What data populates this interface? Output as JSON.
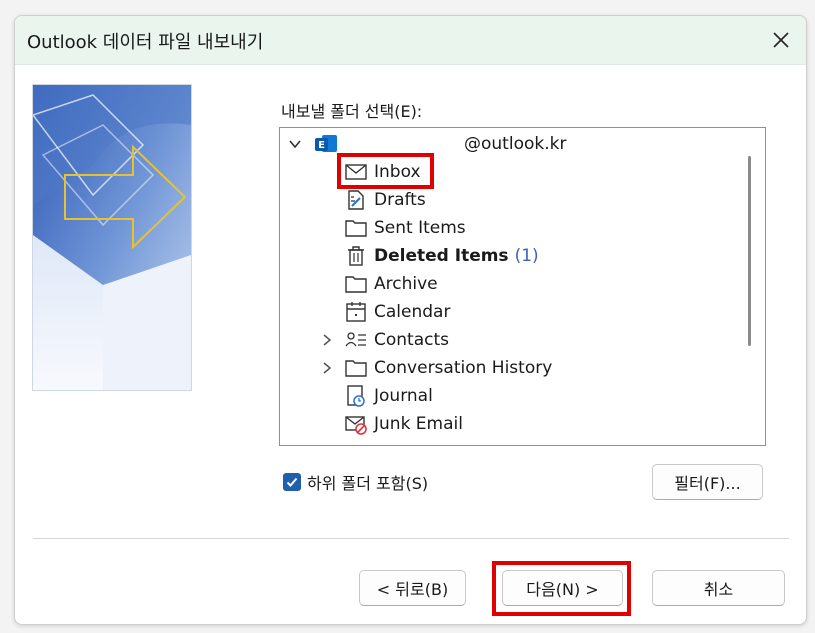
{
  "window": {
    "title": "Outlook 데이터 파일 내보내기"
  },
  "select_label": "내보낼 폴더 선택(E):",
  "account": {
    "email": "@outlook.kr"
  },
  "folders": [
    {
      "label": "Inbox",
      "icon": "mail-icon"
    },
    {
      "label": "Drafts",
      "icon": "drafts-icon"
    },
    {
      "label": "Sent Items",
      "icon": "folder-icon"
    },
    {
      "label": "Deleted Items",
      "icon": "trash-icon",
      "count": "(1)"
    },
    {
      "label": "Archive",
      "icon": "folder-icon"
    },
    {
      "label": "Calendar",
      "icon": "calendar-icon"
    },
    {
      "label": "Contacts",
      "icon": "contacts-icon"
    },
    {
      "label": "Conversation History",
      "icon": "folder-icon"
    },
    {
      "label": "Journal",
      "icon": "journal-icon"
    },
    {
      "label": "Junk Email",
      "icon": "junk-icon"
    }
  ],
  "include_subfolders": {
    "label": "하위 폴더 포함(S)",
    "checked": true
  },
  "buttons": {
    "filter": "필터(F)...",
    "back": "< 뒤로(B)",
    "next": "다음(N) >",
    "cancel": "취소"
  },
  "colors": {
    "titlebar": "#eaf5ee",
    "highlight": "#e00000",
    "checkbox": "#1f5fb0",
    "count": "#3b5fc0"
  }
}
